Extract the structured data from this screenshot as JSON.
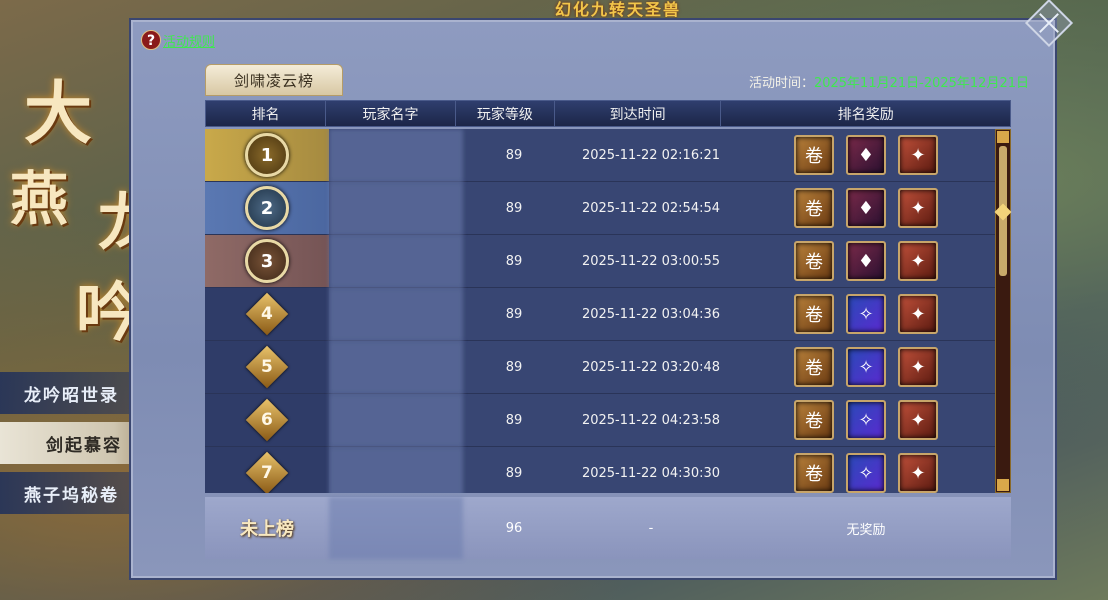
{
  "banner": {
    "top_text": "幻化九转天圣兽"
  },
  "title_art": {
    "chars": [
      "大",
      "燕",
      "龙",
      "吟"
    ]
  },
  "side_menu": {
    "items": [
      {
        "label": "龙吟昭世录"
      },
      {
        "label": "剑起慕容"
      },
      {
        "label": "燕子坞秘卷"
      }
    ],
    "active_index": 1
  },
  "panel": {
    "help_label": "活动规则",
    "tab_label": "剑啸凌云榜",
    "time_label": "活动时间：",
    "time_value": "2025年11月21日-2025年12月21日"
  },
  "table": {
    "headers": [
      "排名",
      "玩家名字",
      "玩家等级",
      "到达时间",
      "排名奖励"
    ],
    "rows": [
      {
        "rank": "1",
        "level": "89",
        "time": "2025-11-22  02:16:21",
        "rewards": [
          "book-icon",
          "character-icon",
          "beast-icon"
        ]
      },
      {
        "rank": "2",
        "level": "89",
        "time": "2025-11-22  02:54:54",
        "rewards": [
          "book-icon",
          "character-icon",
          "beast-icon"
        ]
      },
      {
        "rank": "3",
        "level": "89",
        "time": "2025-11-22  03:00:55",
        "rewards": [
          "book-icon",
          "character-icon",
          "beast-icon"
        ]
      },
      {
        "rank": "4",
        "level": "89",
        "time": "2025-11-22  03:04:36",
        "rewards": [
          "book-icon",
          "wings-icon",
          "beast-icon"
        ]
      },
      {
        "rank": "5",
        "level": "89",
        "time": "2025-11-22  03:20:48",
        "rewards": [
          "book-icon",
          "wings-icon",
          "beast-icon"
        ]
      },
      {
        "rank": "6",
        "level": "89",
        "time": "2025-11-22  04:23:58",
        "rewards": [
          "book-icon",
          "wings-icon",
          "beast-icon"
        ]
      },
      {
        "rank": "7",
        "level": "89",
        "time": "2025-11-22  04:30:30",
        "rewards": [
          "book-icon",
          "wings-icon",
          "beast-icon"
        ]
      }
    ],
    "self": {
      "rank": "未上榜",
      "level": "96",
      "time": "-",
      "reward": "无奖励"
    }
  },
  "colors": {
    "accent_green": "#3fe84f",
    "gold": "#e8c26a"
  }
}
